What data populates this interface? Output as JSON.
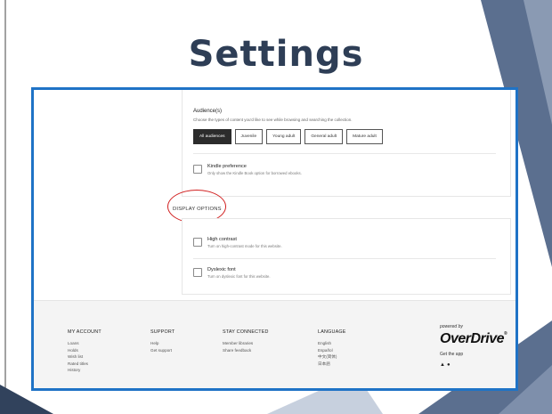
{
  "slide": {
    "title": "Settings"
  },
  "audiences": {
    "heading": "Audience(s)",
    "description": "Choose the types of content you'd like to see while browsing and searching the collection.",
    "options": [
      {
        "label": "All audiences",
        "selected": true
      },
      {
        "label": "Juvenile",
        "selected": false
      },
      {
        "label": "Young adult",
        "selected": false
      },
      {
        "label": "General adult",
        "selected": false
      },
      {
        "label": "Mature adult",
        "selected": false
      }
    ]
  },
  "kindle": {
    "label": "Kindle preference",
    "description": "Only show the Kindle Book option for borrowed ebooks."
  },
  "display_options": {
    "heading": "DISPLAY OPTIONS",
    "high_contrast": {
      "label": "High contrast",
      "description": "Turn on high-contrast mode for this website."
    },
    "dyslexic_font": {
      "label": "Dyslexic font",
      "description": "Turn on dyslexic font for this website."
    }
  },
  "footer": {
    "my_account": {
      "heading": "MY ACCOUNT",
      "links": [
        "Loans",
        "Holds",
        "Wish list",
        "Rated titles",
        "History"
      ]
    },
    "support": {
      "heading": "SUPPORT",
      "links": [
        "Help",
        "Get support"
      ]
    },
    "stay_connected": {
      "heading": "STAY CONNECTED",
      "links": [
        "Member libraries",
        "Share feedback"
      ]
    },
    "language": {
      "heading": "LANGUAGE",
      "links": [
        "English",
        "Español",
        "中文(简体)",
        "日本語"
      ]
    },
    "brand": {
      "powered_by": "powered by",
      "logo": "OverDrive",
      "get_app": "Get the app"
    }
  },
  "colors": {
    "title": "#2e3e56",
    "frame_border": "#1f73c6",
    "annotation_circle": "#d11f1f",
    "selected_pill": "#2c2c2c"
  },
  "icons": [
    "android-icon",
    "apple-icon"
  ]
}
